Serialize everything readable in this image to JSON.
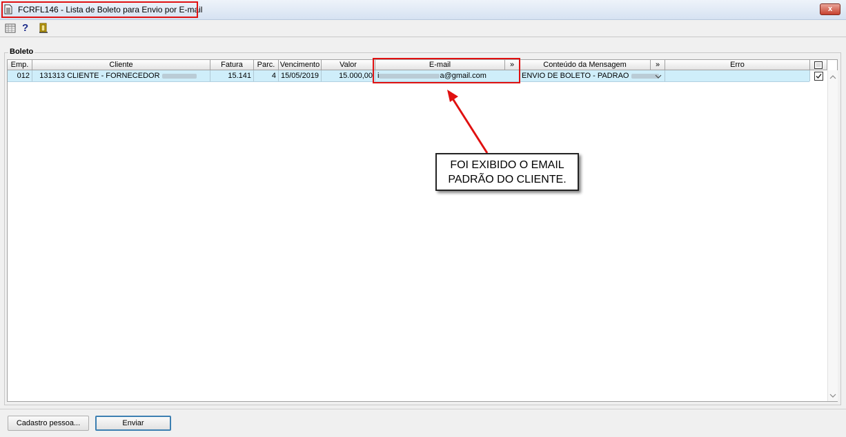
{
  "window": {
    "title": "FCRFL146 - Lista de Boleto para Envio por E-mail",
    "close_label": "x"
  },
  "toolbar": {
    "icons": [
      "grid-icon",
      "help-icon",
      "exit-door-icon"
    ],
    "help_glyph": "?"
  },
  "group": {
    "label": "Boleto"
  },
  "grid": {
    "headers": {
      "emp": "Emp.",
      "cliente": "Cliente",
      "fatura": "Fatura",
      "parc": "Parc.",
      "vencimento": "Vencimento",
      "valor": "Valor",
      "email": "E-mail",
      "email_expand": "»",
      "conteudo": "Conteúdo da Mensagem",
      "conteudo_expand": "»",
      "erro": "Erro"
    },
    "rows": [
      {
        "emp": "012",
        "cliente_code": "131313",
        "cliente_name": "CLIENTE - FORNECEDOR",
        "fatura": "15.141",
        "parc": "4",
        "vencimento": "15/05/2019",
        "valor": "15.000,00",
        "email_prefix": "i",
        "email_suffix": "a@gmail.com",
        "conteudo": "ENVIO DE BOLETO - PADRAO",
        "erro": "",
        "selected": true
      }
    ]
  },
  "annotation": {
    "line1": "FOI EXIBIDO O EMAIL",
    "line2": "PADRÃO DO CLIENTE."
  },
  "buttons": {
    "cadastro": "Cadastro pessoa...",
    "enviar": "Enviar"
  },
  "colors": {
    "highlight_box": "#e01010",
    "row_background": "#cfeefa"
  }
}
